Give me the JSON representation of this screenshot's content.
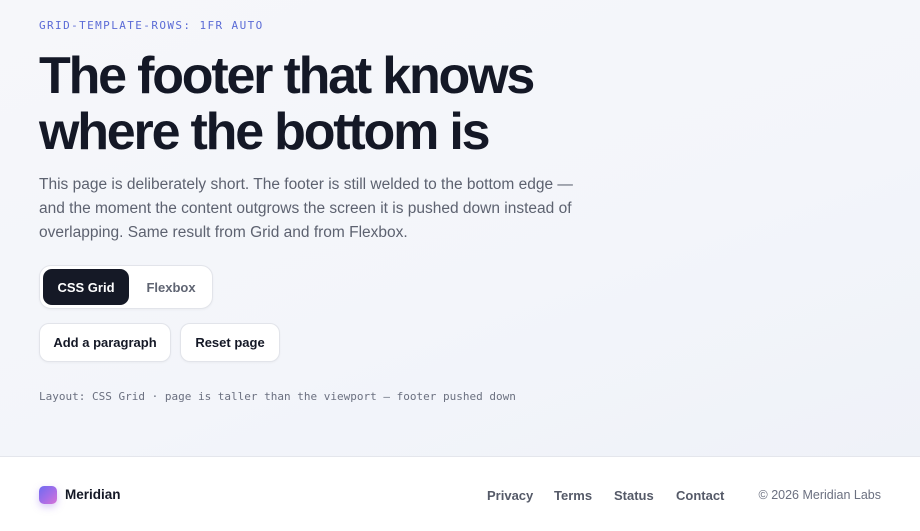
{
  "main": {
    "eyebrow": "GRID-TEMPLATE-ROWS: 1FR AUTO",
    "headline": "The footer that knows where the bottom is",
    "lede": "This page is deliberately short. The footer is still welded to the bottom edge — and the moment the content outgrows the screen it is pushed down instead of overlapping. Same result from Grid and from Flexbox.",
    "layout_toggle": {
      "options": [
        "CSS Grid",
        "Flexbox"
      ],
      "selected": "CSS Grid"
    },
    "actions": {
      "add_paragraph": "Add a paragraph",
      "reset_page": "Reset page"
    },
    "status": "Layout: CSS Grid · page is taller than the viewport — footer pushed down"
  },
  "footer": {
    "brand": "Meridian",
    "brand_icon": "meridian-logo-icon",
    "links": [
      "Privacy",
      "Terms",
      "Status",
      "Contact"
    ],
    "copyright": "© 2026 Meridian Labs"
  },
  "colors": {
    "accent": "#5b6bd6",
    "ink": "#141826",
    "active_toggle": "#151926",
    "logo_gradient": [
      "#6f6cf0",
      "#d873d6"
    ]
  }
}
